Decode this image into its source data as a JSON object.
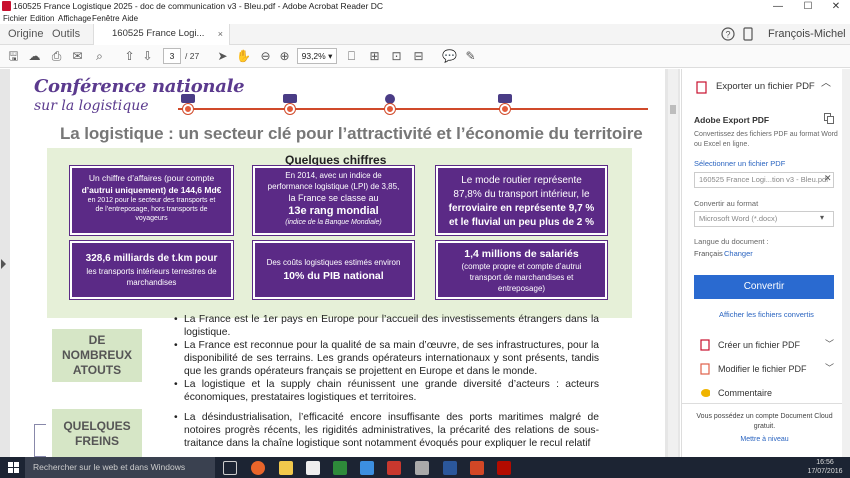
{
  "titlebar": {
    "title": "160525 France Logistique 2025 - doc de communication v3 - Bleu.pdf - Adobe Acrobat Reader DC",
    "minimize": "—",
    "maximize": "☐",
    "close": "✕"
  },
  "menu": [
    "Fichier",
    "Edition",
    "Affichage",
    "Fenêtre",
    "Aide"
  ],
  "tabs": {
    "origine": "Origine",
    "outils": "Outils",
    "document": "160525 France Logi...",
    "document_close": "×",
    "user": "François-Michel"
  },
  "toolbar": {
    "page_current": "3",
    "page_total": "/ 27",
    "zoom": "93,2%"
  },
  "document": {
    "conference_title": "Conférence nationale",
    "conference_subtitle": "sur la logistique",
    "heading": "La logistique : un secteur clé pour l’attractivité et l’économie du territoire",
    "quelques_chiffres": "Quelques chiffres",
    "boxes": [
      {
        "lines": [
          "Un chiffre d’affaires (pour compte",
          "d’autrui uniquement) de 144,6 Md€",
          "en 2012 pour le secteur des transports et",
          "de l’entreposage, hors transports de",
          "voyageurs"
        ]
      },
      {
        "lines": [
          "En 2014, avec un indice de",
          "performance logistique (LPI) de 3,85,",
          "la France se classe au",
          "13e rang mondial",
          "(indice de la Banque Mondiale)"
        ]
      },
      {
        "lines": [
          "Le mode routier représente",
          "87,8% du transport intérieur, le",
          "ferroviaire en représente 9,7 %",
          "et le fluvial un peu plus de 2 %"
        ]
      },
      {
        "lines": [
          "328,6 milliards de t.km pour",
          "les transports intérieurs terrestres de",
          "marchandises"
        ]
      },
      {
        "lines": [
          "Des coûts logistiques estimés  environ",
          "10% du PIB national"
        ]
      },
      {
        "lines": [
          "1,4 millions de salariés",
          "(compte propre et compte d’autrui",
          "transport de marchandises et",
          "entreposage)"
        ]
      }
    ],
    "side_label_1": [
      "DE",
      "NOMBREUX",
      "ATOUTS"
    ],
    "side_label_2": [
      "QUELQUES",
      "FREINS"
    ],
    "bullets_atouts": [
      "La France est le 1er pays en Europe pour l’accueil des investissements étrangers dans la logistique.",
      "La France est reconnue pour la qualité de sa main d’œuvre, de ses infrastructures, pour la disponibilité de ses terrains. Les grands opérateurs internationaux y sont présents, tandis que les grands opérateurs français se projettent en Europe et dans le monde.",
      "La logistique et la supply chain réunissent une grande diversité d’acteurs : acteurs économiques, prestataires logistiques et territoires."
    ],
    "bullets_freins": [
      "La désindustrialisation, l’efficacité encore insuffisante des ports maritimes malgré de notoires progrès récents, les rigidités administratives, la précarité des relations de sous-traitance dans la chaîne logistique sont notamment évoqués pour expliquer le recul relatif"
    ]
  },
  "right_panel": {
    "export_header": "Exporter un fichier PDF",
    "adobe_export_title": "Adobe Export PDF",
    "adobe_export_desc": "Convertissez des fichiers PDF au format Word ou Excel en ligne.",
    "select_file_link": "Sélectionner un fichier PDF",
    "selected_file": "160525 France Logi...tion v3 - Bleu.pdf",
    "convert_to_label": "Convertir au format",
    "format_value": "Microsoft Word (*.docx)",
    "doc_language_label": "Langue du document :",
    "doc_language_value": "Français",
    "change_link": "Changer",
    "convert_button": "Convertir",
    "view_converted_link": "Afficher les fichiers convertis",
    "tools": [
      "Créer un fichier PDF",
      "Modifier le fichier PDF",
      "Commentaire"
    ],
    "cloud_text": "Vous possédez un compte Document Cloud gratuit.",
    "upgrade_link": "Mettre à niveau"
  },
  "taskbar": {
    "search_placeholder": "Rechercher sur le web et dans Windows",
    "time": "16:56",
    "date": "17/07/2016"
  },
  "colors": {
    "accent_purple": "#5b2a86",
    "panel_green": "#e6f0d8",
    "acrobat_blue": "#2a6ad0",
    "taskbar": "#1c2433"
  }
}
